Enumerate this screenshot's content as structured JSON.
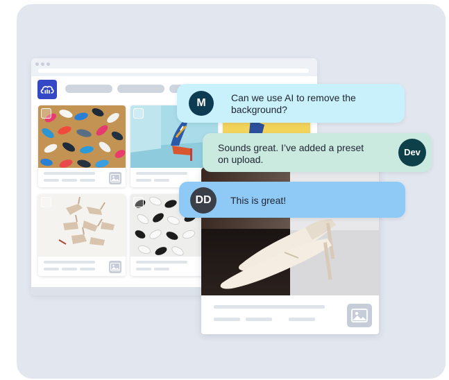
{
  "chat": {
    "messages": [
      {
        "avatar": "M",
        "text_line1": "Can we use AI to remove the",
        "text_line2": "background?",
        "color": "#c9f1fb",
        "avatar_color": "#0d3c52"
      },
      {
        "avatar": "Dev",
        "text_line1": "Sounds great. I’ve added a preset",
        "text_line2": "on upload.",
        "color": "#cbeadf",
        "avatar_color": "#0d4048"
      },
      {
        "avatar": "DD",
        "text_line1": "This is great!",
        "color": "#8fcaf7",
        "avatar_color": "#3a3f48"
      }
    ]
  },
  "icons": {
    "logo": "cloud-logo-icon",
    "image_placeholder": "image-icon",
    "checkbox": "checkbox-icon"
  },
  "colors": {
    "background_panel": "#e2e6ee",
    "brand": "#3448c5",
    "placeholder": "#dfe3ea"
  }
}
